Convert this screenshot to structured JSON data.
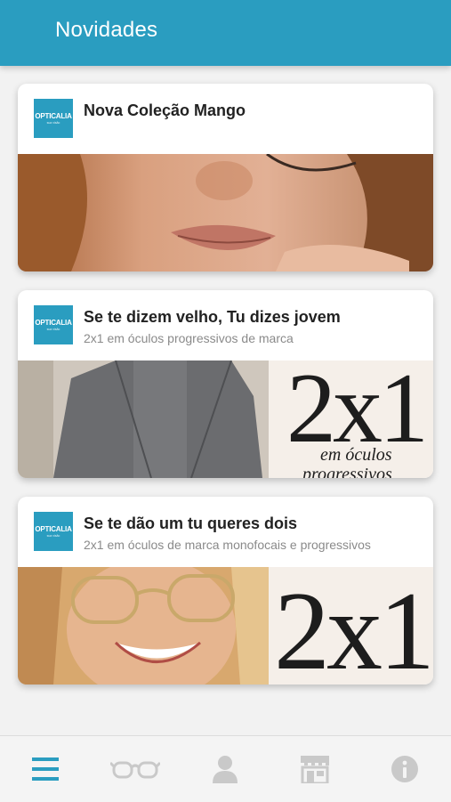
{
  "header": {
    "title": "Novidades"
  },
  "brand": {
    "logo_text": "OPTICALIA",
    "logo_tagline": "sua visão",
    "color": "#2a9dc0"
  },
  "cards": [
    {
      "title": "Nova Coleção Mango",
      "subtitle": ""
    },
    {
      "title": "Se te dizem velho, Tu dizes jovem",
      "subtitle": "2x1 em óculos progressivos de marca",
      "promo_big": "2x1",
      "promo_line1": "em óculos",
      "promo_line2": "progressivos"
    },
    {
      "title": "Se te dão um tu queres dois",
      "subtitle": "2x1 em óculos de marca monofocais e progressivos",
      "promo_big": "2x1"
    }
  ],
  "tabbar": {
    "active_color": "#2a9dc0",
    "inactive_color": "#c9c9c9",
    "tabs": [
      {
        "icon": "menu-icon",
        "active": true
      },
      {
        "icon": "glasses-icon",
        "active": false
      },
      {
        "icon": "user-icon",
        "active": false
      },
      {
        "icon": "store-icon",
        "active": false
      },
      {
        "icon": "info-icon",
        "active": false
      }
    ]
  }
}
